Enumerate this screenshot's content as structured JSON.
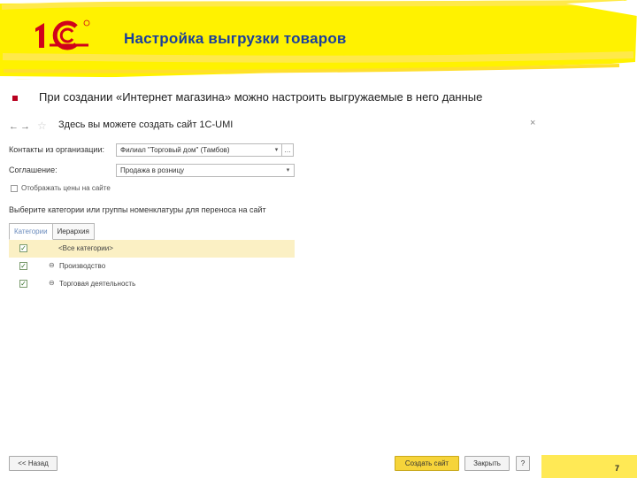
{
  "slide": {
    "title": "Настройка выгрузки товаров",
    "bullet": "При создании «Интернет магазина» можно настроить выгружаемые в него данные",
    "page_number": "7"
  },
  "colors": {
    "banner_yellow": "#fff200",
    "banner_stripe": "#ffe94a",
    "logo_red": "#d0021b",
    "title_blue": "#1a3f9c",
    "create_button": "#f6d43a",
    "selected_row": "#fbf0c4"
  },
  "form": {
    "nav": {
      "back_icon": "arrow-left-icon",
      "forward_icon": "arrow-right-icon",
      "back_glyph": "←",
      "forward_glyph": "→"
    },
    "favorite_icon": "star-icon",
    "title": "Здесь вы можете создать сайт 1С-UMI",
    "close_glyph": "×",
    "fields": {
      "contacts_label": "Контакты из организации:",
      "contacts_value": "Филиал \"Торговый дом\" (Тамбов)",
      "agreement_label": "Соглашение:",
      "agreement_value": "Продажа в розницу"
    },
    "show_prices_label": "Отображать цены на сайте",
    "section_heading": "Выберите категории или группы номенклатуры для переноса на сайт",
    "tabs": [
      "Категории",
      "Иерархия"
    ],
    "rows": [
      {
        "label": "<Все категории>",
        "checked": true,
        "tree": ""
      },
      {
        "label": "Производство",
        "checked": true,
        "tree": "⊖"
      },
      {
        "label": "Торговая деятельность",
        "checked": true,
        "tree": "⊖"
      }
    ],
    "buttons": {
      "back": "<< Назад",
      "create": "Создать сайт",
      "close": "Закрыть",
      "help": "?"
    }
  }
}
